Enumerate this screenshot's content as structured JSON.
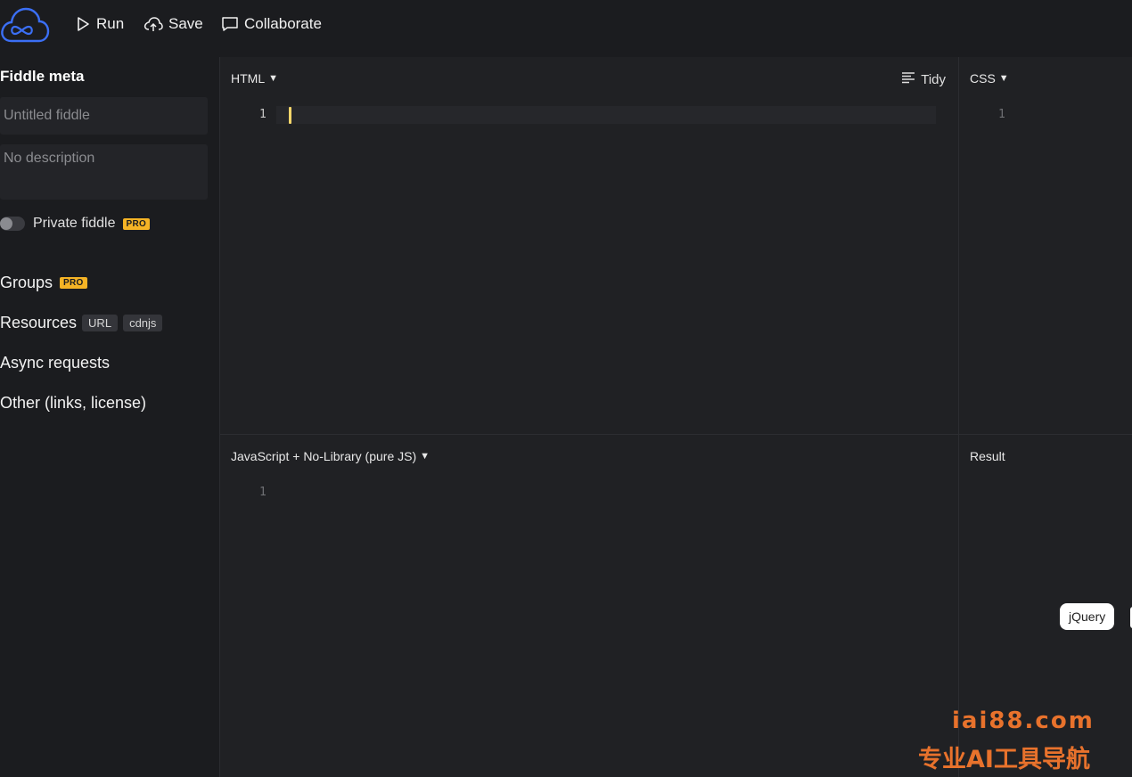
{
  "toolbar": {
    "run_label": "Run",
    "save_label": "Save",
    "collaborate_label": "Collaborate"
  },
  "sidebar": {
    "meta_title": "Fiddle meta",
    "title_placeholder": "Untitled fiddle",
    "description_placeholder": "No description",
    "private_label": "Private fiddle",
    "pro_badge": "PRO",
    "groups_label": "Groups",
    "resources_label": "Resources",
    "resources_chips": [
      "URL",
      "cdnjs"
    ],
    "async_label": "Async requests",
    "other_label": "Other (links, license)"
  },
  "panels": {
    "html": {
      "label": "HTML",
      "tidy_label": "Tidy",
      "line_number": "1"
    },
    "css": {
      "label": "CSS",
      "line_number": "1"
    },
    "js": {
      "label": "JavaScript + No-Library (pure JS)",
      "line_number": "1"
    },
    "result": {
      "label": "Result",
      "framework_button": "jQuery"
    }
  },
  "watermark": {
    "domain": "iai88.com",
    "tagline": "专业AI工具导航"
  },
  "colors": {
    "background": "#1b1c1f",
    "panel": "#202124",
    "accent_logo": "#3b6ff5",
    "pro_badge": "#f5b325",
    "cursor": "#f4d56a",
    "watermark": "#e8722c"
  }
}
